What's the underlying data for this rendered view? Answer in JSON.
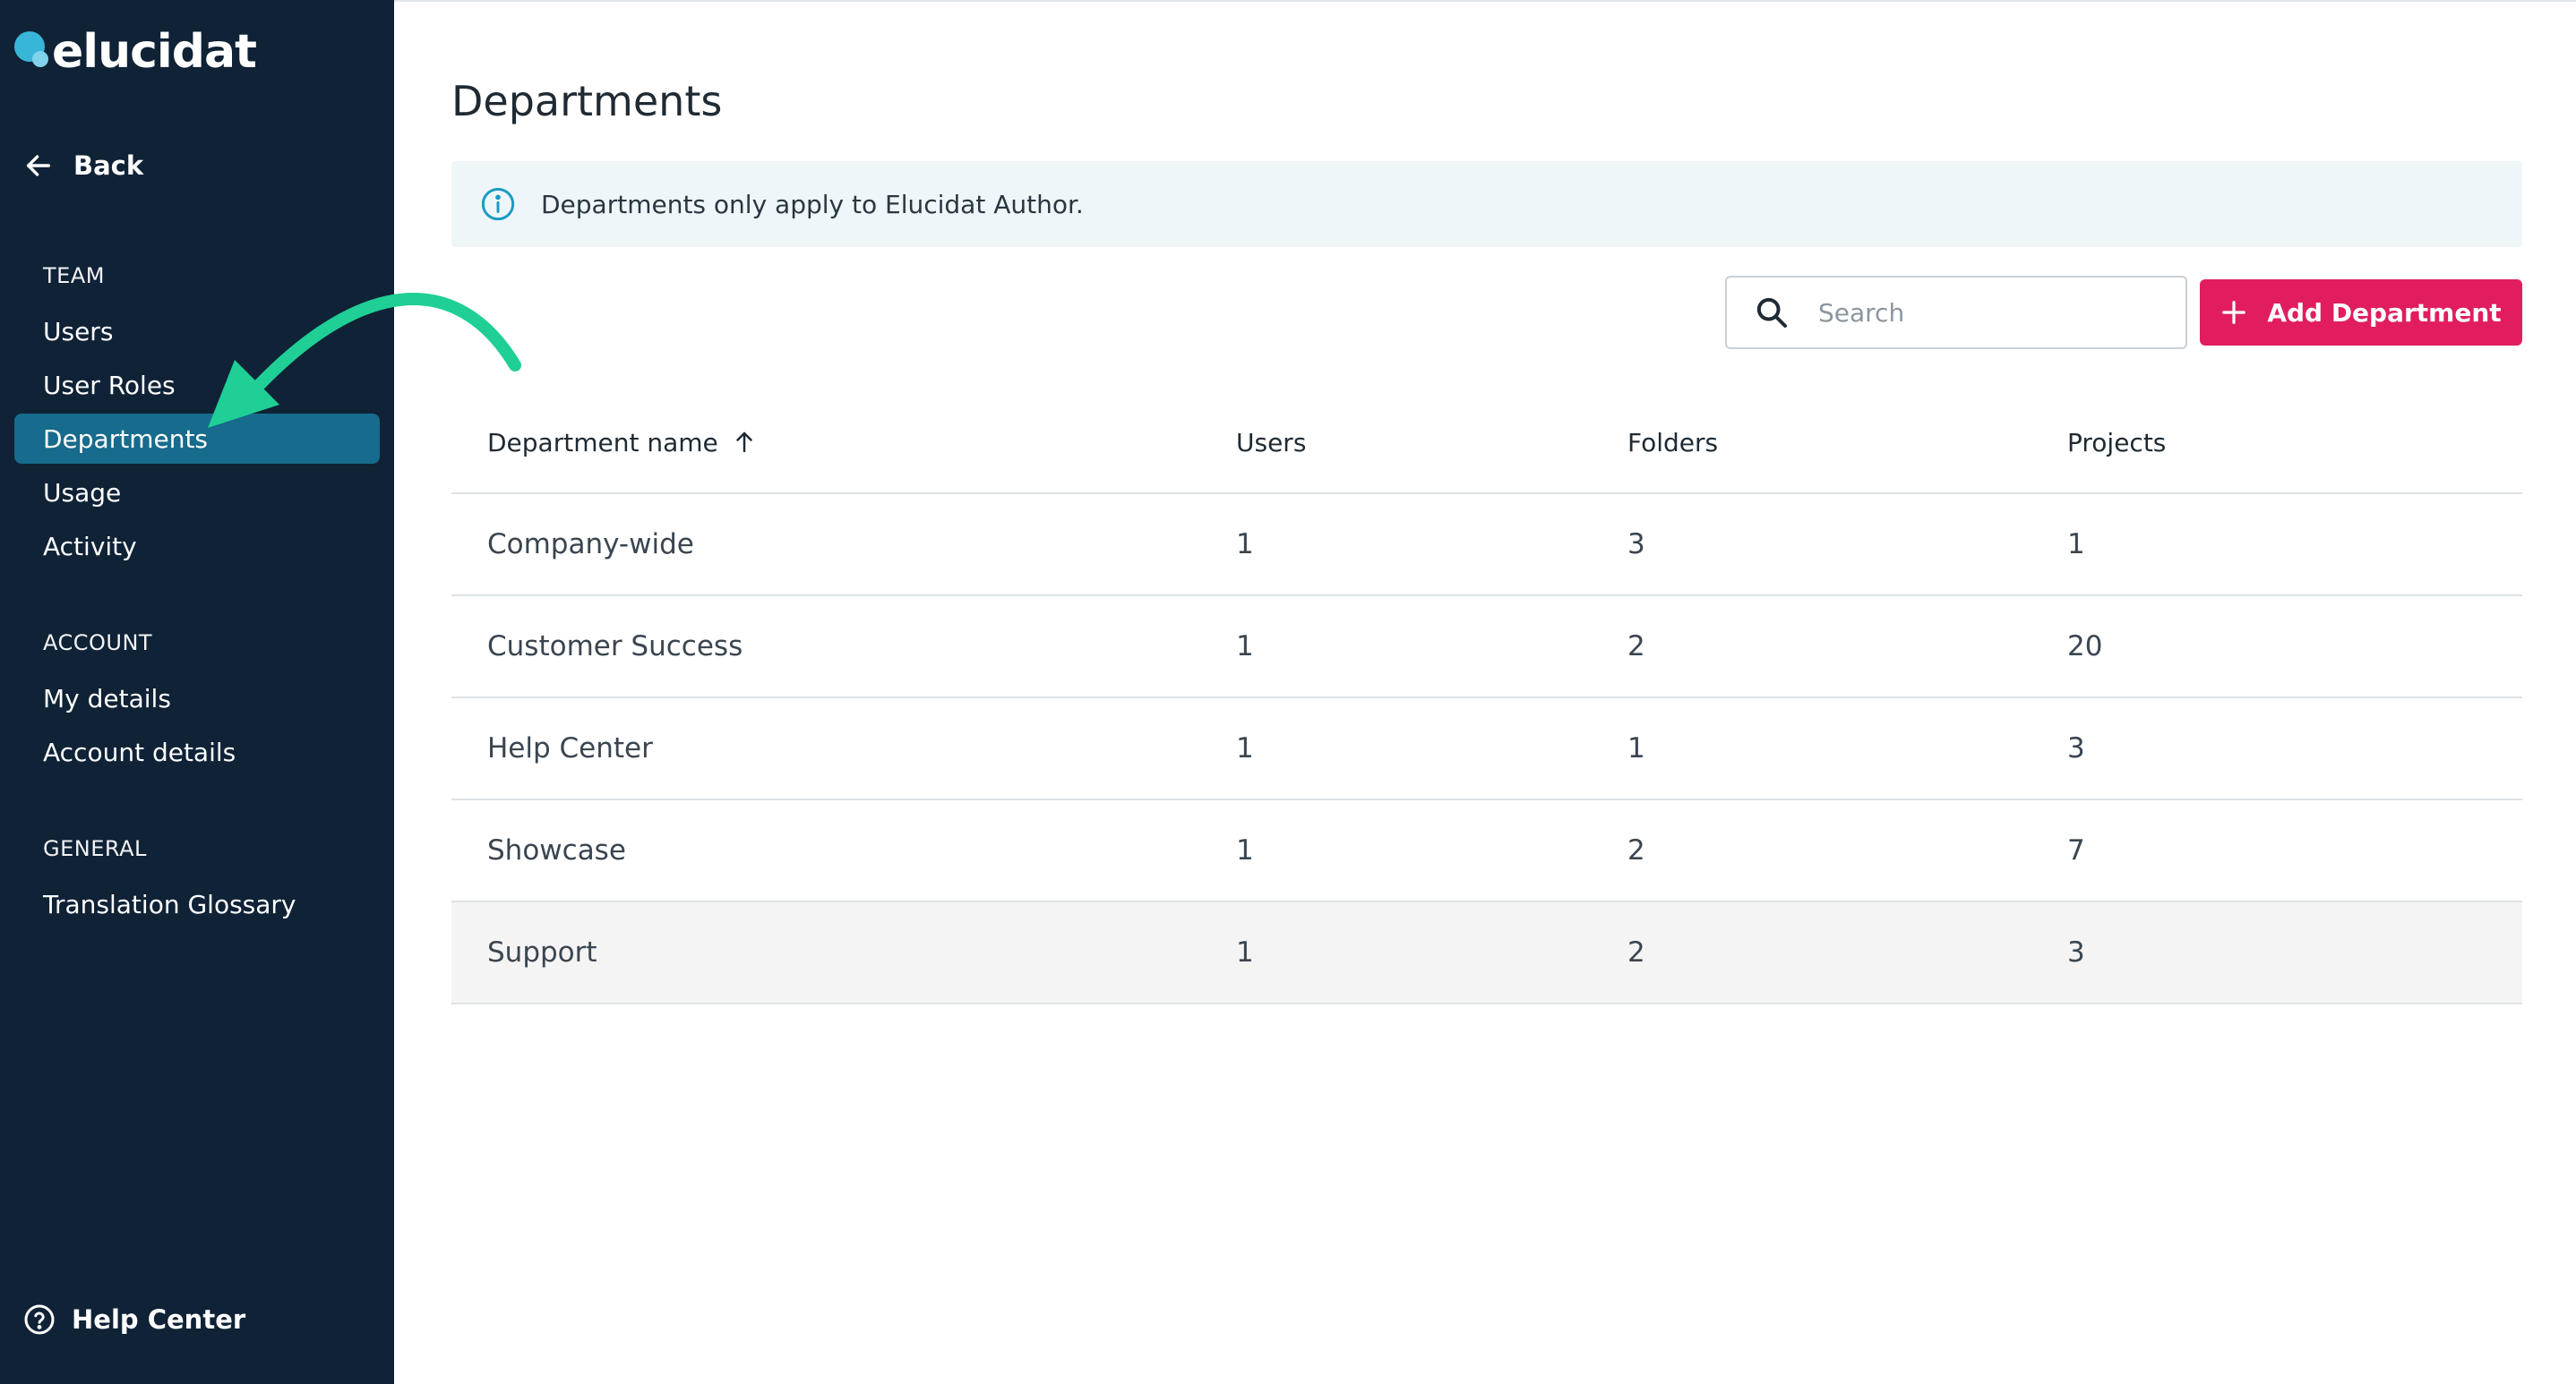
{
  "app": {
    "brand": "elucidat",
    "accent_color": "#e11d5f",
    "sidebar_color": "#0f2236",
    "active_nav_color": "#176b8c",
    "annotation_color": "#1fcf95"
  },
  "sidebar": {
    "back_label": "Back",
    "sections": [
      {
        "title": "TEAM",
        "items": [
          {
            "label": "Users"
          },
          {
            "label": "User Roles"
          },
          {
            "label": "Departments",
            "active": true
          },
          {
            "label": "Usage"
          },
          {
            "label": "Activity"
          }
        ]
      },
      {
        "title": "ACCOUNT",
        "items": [
          {
            "label": "My details"
          },
          {
            "label": "Account details"
          }
        ]
      },
      {
        "title": "GENERAL",
        "items": [
          {
            "label": "Translation Glossary"
          }
        ]
      }
    ],
    "help_label": "Help Center"
  },
  "main": {
    "title": "Departments",
    "info_text": "Departments only apply to Elucidat Author.",
    "search": {
      "placeholder": "Search",
      "value": ""
    },
    "add_button_label": "Add Department",
    "table": {
      "columns": [
        "Department name",
        "Users",
        "Folders",
        "Projects"
      ],
      "sort_icon": "arrow-up-icon",
      "rows": [
        {
          "name": "Company-wide",
          "users": "1",
          "folders": "3",
          "projects": "1"
        },
        {
          "name": "Customer Success",
          "users": "1",
          "folders": "2",
          "projects": "20"
        },
        {
          "name": "Help Center",
          "users": "1",
          "folders": "1",
          "projects": "3"
        },
        {
          "name": "Showcase",
          "users": "1",
          "folders": "2",
          "projects": "7"
        },
        {
          "name": "Support",
          "users": "1",
          "folders": "2",
          "projects": "3",
          "hovered": true
        }
      ]
    }
  }
}
